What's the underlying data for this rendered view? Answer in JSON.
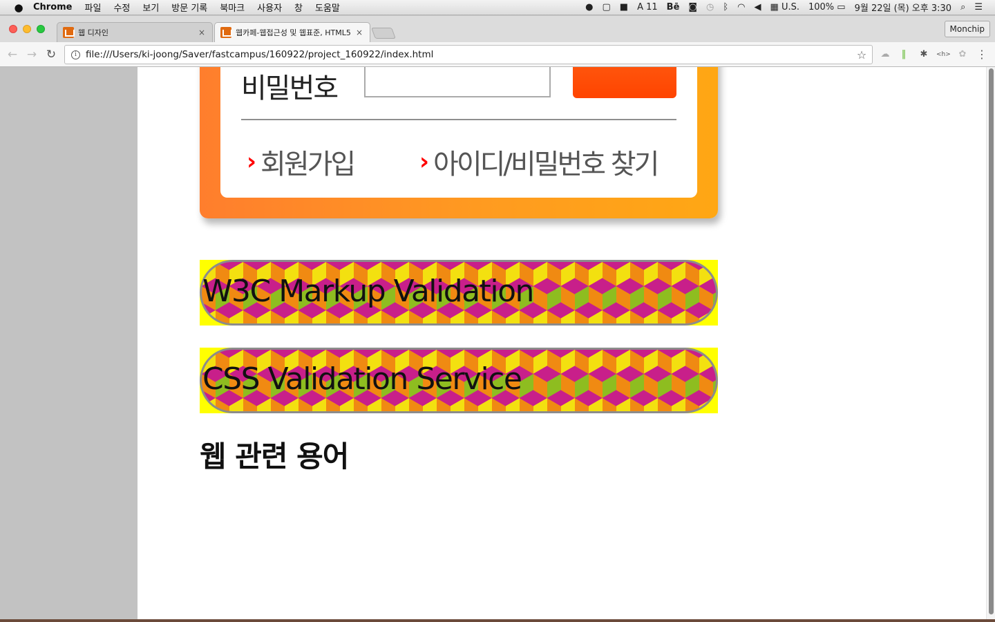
{
  "menubar": {
    "apple": "",
    "app": "Chrome",
    "items": [
      "파일",
      "수정",
      "보기",
      "방문 기록",
      "북마크",
      "사용자",
      "창",
      "도움말"
    ],
    "status": {
      "notif_count": "11",
      "behance": "Bē",
      "input_source": "U.S.",
      "battery": "100%",
      "datetime": "9월 22일 (목) 오후 3:30"
    }
  },
  "browser": {
    "tabs": [
      {
        "title": "웹 디자인",
        "close": "×"
      },
      {
        "title": "웹카페-웹접근성 및 웹표준, HTML5",
        "close": "×"
      }
    ],
    "profile": "Monchip",
    "url": "file:///Users/ki-joong/Saver/fastcampus/160922/project_160922/index.html",
    "icons": {
      "back": "←",
      "forward": "→",
      "reload": "↻",
      "info": "i",
      "star": "☆",
      "menu": "⋮"
    }
  },
  "page": {
    "login": {
      "password_label": "비밀번호",
      "chevron": "›",
      "join_link": "회원가입",
      "find_link": "아이디/비밀번호 찾기"
    },
    "validators": {
      "w3c": "W3C Markup Validation",
      "css": "CSS Validation Service"
    },
    "terms_heading": "웹 관련 용어"
  },
  "colors": {
    "login_gradient_start": "#ff7e2d",
    "login_gradient_end": "#ffa714",
    "login_button": "#ff4400",
    "chevron": "#ff0000",
    "validator_bg": "#ffff00"
  }
}
